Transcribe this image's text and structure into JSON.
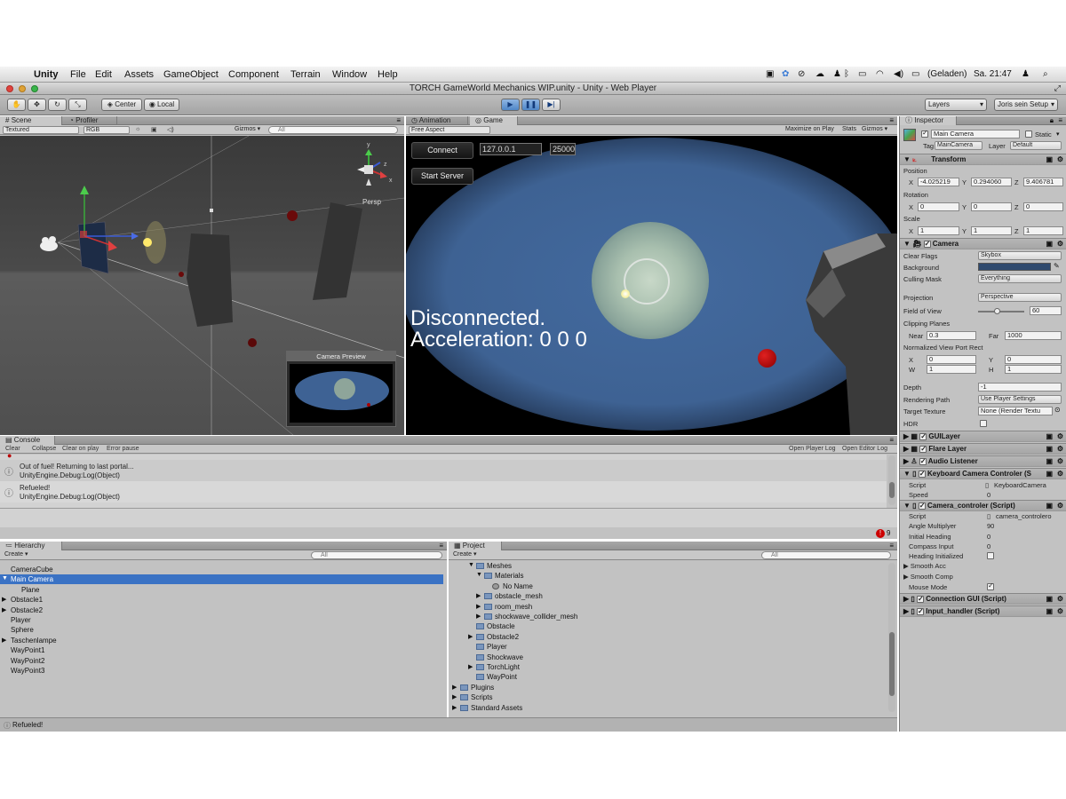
{
  "menubar": {
    "apple": "",
    "items": [
      "Unity",
      "File",
      "Edit",
      "Assets",
      "GameObject",
      "Component",
      "Terrain",
      "Window",
      "Help"
    ],
    "battery": "(Geladen)",
    "clock": "Sa. 21:47"
  },
  "window": {
    "title": "TORCH GameWorld Mechanics WIP.unity - Unity - Web Player"
  },
  "toolbar": {
    "pivot_center": "Center",
    "pivot_local": "Local",
    "layers": "Layers",
    "layout": "Joris sein Setup"
  },
  "scene": {
    "tab_scene": "Scene",
    "tab_profiler": "Profiler",
    "render_mode": "Textured",
    "color_mode": "RGB",
    "gizmos": "Gizmos",
    "search_placeholder": "All",
    "persp": "Persp",
    "camera_preview": "Camera Preview"
  },
  "game": {
    "tab_animation": "Animation",
    "tab_game": "Game",
    "aspect": "Free Aspect",
    "maximize": "Maximize on Play",
    "stats": "Stats",
    "gizmos": "Gizmos",
    "connect": "Connect",
    "ip": "127.0.0.1",
    "port": "25000",
    "start_server": "Start Server",
    "status_line1": "Disconnected.",
    "status_line2": "Acceleration: 0 0 0"
  },
  "console": {
    "tab": "Console",
    "buttons": [
      "Clear",
      "Collapse",
      "Clear on play",
      "Error pause"
    ],
    "right_buttons": [
      "Open Player Log",
      "Open Editor Log"
    ],
    "entries": [
      {
        "line1": "Out of fuel! Returning to last portal...",
        "line2": "UnityEngine.Debug:Log(Object)"
      },
      {
        "line1": "Refueled!",
        "line2": "UnityEngine.Debug:Log(Object)"
      }
    ],
    "error_count": "9"
  },
  "hierarchy": {
    "tab": "Hierarchy",
    "create": "Create",
    "search_placeholder": "All",
    "items": [
      {
        "label": "CameraCube",
        "arrow": "",
        "indent": 0
      },
      {
        "label": "Main Camera",
        "arrow": "▼",
        "indent": 0,
        "selected": true
      },
      {
        "label": "Plane",
        "arrow": "",
        "indent": 1
      },
      {
        "label": "Obstacle1",
        "arrow": "▶",
        "indent": 0
      },
      {
        "label": "Obstacle2",
        "arrow": "▶",
        "indent": 0
      },
      {
        "label": "Player",
        "arrow": "",
        "indent": 0
      },
      {
        "label": "Sphere",
        "arrow": "",
        "indent": 0
      },
      {
        "label": "Taschenlampe",
        "arrow": "▶",
        "indent": 0
      },
      {
        "label": "WayPoint1",
        "arrow": "",
        "indent": 0
      },
      {
        "label": "WayPoint2",
        "arrow": "",
        "indent": 0
      },
      {
        "label": "WayPoint3",
        "arrow": "",
        "indent": 0
      }
    ]
  },
  "project": {
    "tab": "Project",
    "create": "Create",
    "search_placeholder": "All",
    "items": [
      {
        "label": "Meshes",
        "arrow": "▼",
        "indent": 2
      },
      {
        "label": "Materials",
        "arrow": "▼",
        "indent": 3
      },
      {
        "label": "No Name",
        "arrow": "",
        "indent": 4
      },
      {
        "label": "obstacle_mesh",
        "arrow": "▶",
        "indent": 3
      },
      {
        "label": "room_mesh",
        "arrow": "▶",
        "indent": 3
      },
      {
        "label": "shockwave_collider_mesh",
        "arrow": "▶",
        "indent": 3
      },
      {
        "label": "Obstacle",
        "arrow": "",
        "indent": 2
      },
      {
        "label": "Obstacle2",
        "arrow": "▶",
        "indent": 2
      },
      {
        "label": "Player",
        "arrow": "",
        "indent": 2
      },
      {
        "label": "Shockwave",
        "arrow": "",
        "indent": 2
      },
      {
        "label": "TorchLight",
        "arrow": "▶",
        "indent": 2
      },
      {
        "label": "WayPoint",
        "arrow": "",
        "indent": 2
      },
      {
        "label": "Plugins",
        "arrow": "▶",
        "indent": 0
      },
      {
        "label": "Scripts",
        "arrow": "▶",
        "indent": 0
      },
      {
        "label": "Standard Assets",
        "arrow": "▶",
        "indent": 0
      }
    ]
  },
  "status": {
    "message": "Refueled!"
  },
  "inspector": {
    "tab": "Inspector",
    "object_name": "Main Camera",
    "static": "Static",
    "tag_label": "Tag",
    "tag": "MainCamera",
    "layer_label": "Layer",
    "layer": "Default",
    "transform": {
      "title": "Transform",
      "position": "Position",
      "pos_x": "-4.025219",
      "pos_y": "0.294060",
      "pos_z": "9.406781",
      "rotation": "Rotation",
      "rot_x": "0",
      "rot_y": "0",
      "rot_z": "0",
      "scale": "Scale",
      "scl_x": "1",
      "scl_y": "1",
      "scl_z": "1",
      "x": "X",
      "y": "Y",
      "z": "Z"
    },
    "camera": {
      "title": "Camera",
      "clear_flags": "Clear Flags",
      "clear_flags_val": "Skybox",
      "background": "Background",
      "background_color": "#2f4a6e",
      "culling_mask": "Culling Mask",
      "culling_mask_val": "Everything",
      "projection": "Projection",
      "projection_val": "Perspective",
      "fov": "Field of View",
      "fov_val": "60",
      "clipping": "Clipping Planes",
      "near": "Near",
      "near_val": "0.3",
      "far": "Far",
      "far_val": "1000",
      "viewport": "Normalized View Port Rect",
      "vx": "X",
      "vx_val": "0",
      "vy": "Y",
      "vy_val": "0",
      "vw": "W",
      "vw_val": "1",
      "vh": "H",
      "vh_val": "1",
      "depth": "Depth",
      "depth_val": "-1",
      "rendering_path": "Rendering Path",
      "rendering_path_val": "Use Player Settings",
      "target_texture": "Target Texture",
      "target_texture_val": "None (Render Textu",
      "hdr": "HDR"
    },
    "gui_layer": "GUILayer",
    "flare_layer": "Flare Layer",
    "audio_listener": "Audio Listener",
    "kbd_controller": {
      "title": "Keyboard Camera Controler (S",
      "script": "Script",
      "script_val": "KeyboardCamera",
      "speed": "Speed",
      "speed_val": "0"
    },
    "cam_controller": {
      "title": "Camera_controler (Script)",
      "script": "Script",
      "script_val": "camera_controlero",
      "angle": "Angle Multiplyer",
      "angle_val": "90",
      "heading": "Initial Heading",
      "heading_val": "0",
      "compass": "Compass Input",
      "compass_val": "0",
      "heading_init": "Heading Initialized",
      "smooth_acc": "Smooth Acc",
      "smooth_comp": "Smooth Comp",
      "mouse_mode": "Mouse Mode"
    },
    "connection_gui": "Connection GUI (Script)",
    "input_handler": "Input_handler (Script)"
  }
}
